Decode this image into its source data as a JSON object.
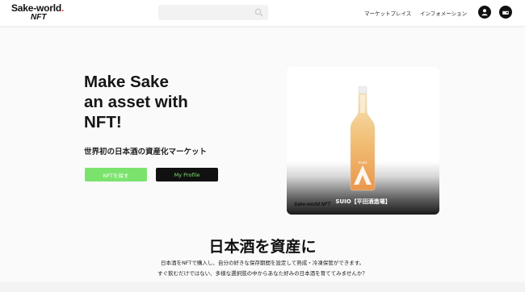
{
  "header": {
    "logo_top": "Sake-world",
    "logo_dot": ".",
    "logo_bottom": "NFT",
    "search": {
      "placeholder": ""
    },
    "nav": {
      "market": "マーケットプレイス",
      "info": "インフォメーション"
    },
    "icons": {
      "search": "search-icon",
      "user": "user-icon",
      "wallet": "wallet-icon"
    }
  },
  "hero": {
    "title_lines": [
      "Make Sake",
      "an asset with",
      "NFT!"
    ],
    "subtitle": "世界初の日本酒の資産化マーケット",
    "buttons": {
      "find_nft": "NFTを探す",
      "my_profile": "My Profile"
    }
  },
  "featured": {
    "name": "SUIO【平田酒造場】",
    "brand": "Sake-world NFT",
    "bottle_label": "SUIO"
  },
  "section": {
    "title": "日本酒を資産に",
    "lines": [
      "日本酒をNFTで購入し、自分の好きな保存期間を設定して熟成・冷凍保管ができます。",
      "すぐ飲むだけではない、多様な選択肢の中からあなた好みの日本酒を育ててみませんか？"
    ]
  },
  "colors": {
    "accent_green": "#7be36d",
    "dark": "#111111",
    "logo_dot": "#e53935"
  }
}
